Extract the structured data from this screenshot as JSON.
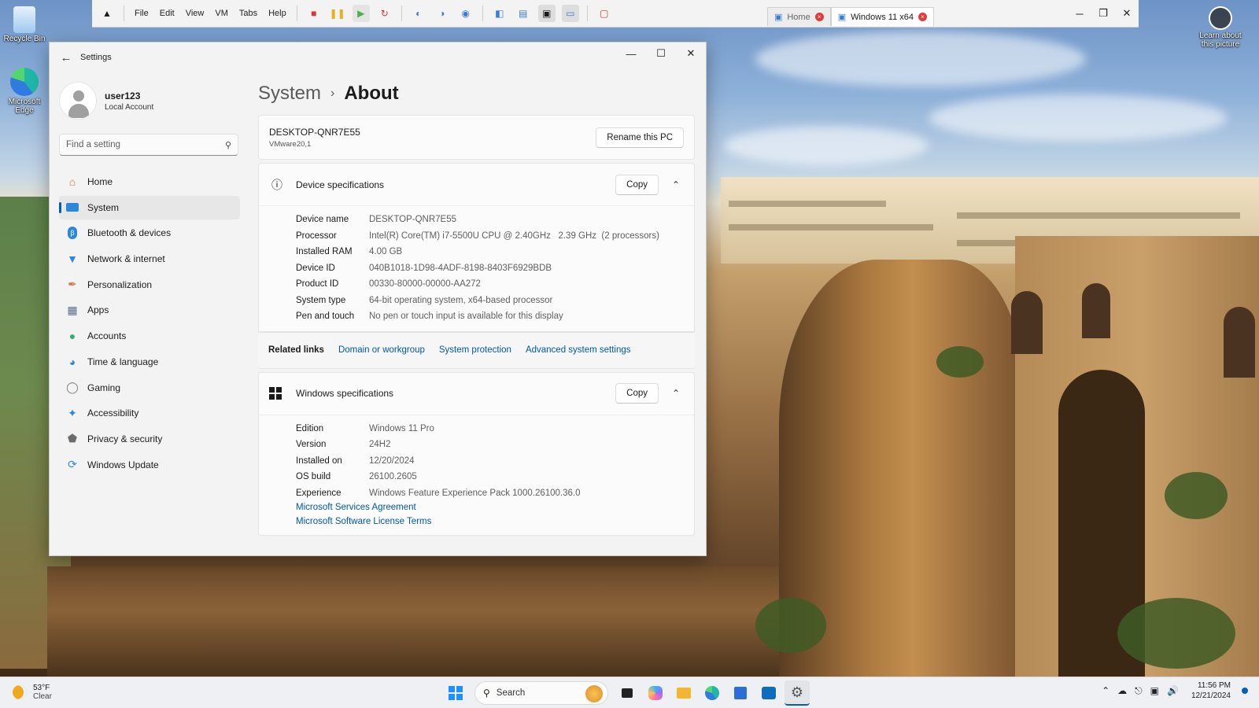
{
  "desktop": {
    "icons": [
      {
        "label": "Recycle Bin"
      },
      {
        "label": "Microsoft Edge"
      }
    ],
    "learn_label": "Learn about this picture"
  },
  "vmware": {
    "menus": [
      "File",
      "Edit",
      "View",
      "VM",
      "Tabs",
      "Help"
    ],
    "tabs": [
      {
        "label": "Home"
      },
      {
        "label": "Windows 11 x64"
      }
    ]
  },
  "settings": {
    "app_title": "Settings",
    "user": {
      "name": "user123",
      "account_type": "Local Account"
    },
    "search_placeholder": "Find a setting",
    "nav": [
      {
        "label": "Home",
        "icon": "home-icon"
      },
      {
        "label": "System",
        "icon": "system-icon",
        "active": true
      },
      {
        "label": "Bluetooth & devices",
        "icon": "bluetooth-icon"
      },
      {
        "label": "Network & internet",
        "icon": "wifi-icon"
      },
      {
        "label": "Personalization",
        "icon": "brush-icon"
      },
      {
        "label": "Apps",
        "icon": "apps-icon"
      },
      {
        "label": "Accounts",
        "icon": "account-icon"
      },
      {
        "label": "Time & language",
        "icon": "globe-icon"
      },
      {
        "label": "Gaming",
        "icon": "gamepad-icon"
      },
      {
        "label": "Accessibility",
        "icon": "accessibility-icon"
      },
      {
        "label": "Privacy & security",
        "icon": "shield-icon"
      },
      {
        "label": "Windows Update",
        "icon": "update-icon"
      }
    ],
    "breadcrumb": {
      "parent": "System",
      "current": "About"
    },
    "pc": {
      "name": "DESKTOP-QNR7E55",
      "model": "VMware20,1",
      "rename_label": "Rename this PC"
    },
    "device_specs": {
      "title": "Device specifications",
      "copy_label": "Copy",
      "rows": [
        {
          "key": "Device name",
          "value": "DESKTOP-QNR7E55"
        },
        {
          "key": "Processor",
          "value": "Intel(R) Core(TM) i7-5500U CPU @ 2.40GHz   2.39 GHz  (2 processors)"
        },
        {
          "key": "Installed RAM",
          "value": "4.00 GB"
        },
        {
          "key": "Device ID",
          "value": "040B1018-1D98-4ADF-8198-8403F6929BDB"
        },
        {
          "key": "Product ID",
          "value": "00330-80000-00000-AA272"
        },
        {
          "key": "System type",
          "value": "64-bit operating system, x64-based processor"
        },
        {
          "key": "Pen and touch",
          "value": "No pen or touch input is available for this display"
        }
      ]
    },
    "related": {
      "label": "Related links",
      "links": [
        "Domain or workgroup",
        "System protection",
        "Advanced system settings"
      ]
    },
    "windows_specs": {
      "title": "Windows specifications",
      "copy_label": "Copy",
      "rows": [
        {
          "key": "Edition",
          "value": "Windows 11 Pro"
        },
        {
          "key": "Version",
          "value": "24H2"
        },
        {
          "key": "Installed on",
          "value": "12/20/2024"
        },
        {
          "key": "OS build",
          "value": "26100.2605"
        },
        {
          "key": "Experience",
          "value": "Windows Feature Experience Pack 1000.26100.36.0"
        }
      ],
      "links": [
        "Microsoft Services Agreement",
        "Microsoft Software License Terms"
      ]
    }
  },
  "taskbar": {
    "weather": {
      "temp": "53°F",
      "desc": "Clear"
    },
    "search_label": "Search",
    "clock": {
      "time": "11:56 PM",
      "date": "12/21/2024"
    }
  },
  "colors": {
    "accent": "#005fb8",
    "link": "#0058a8"
  }
}
